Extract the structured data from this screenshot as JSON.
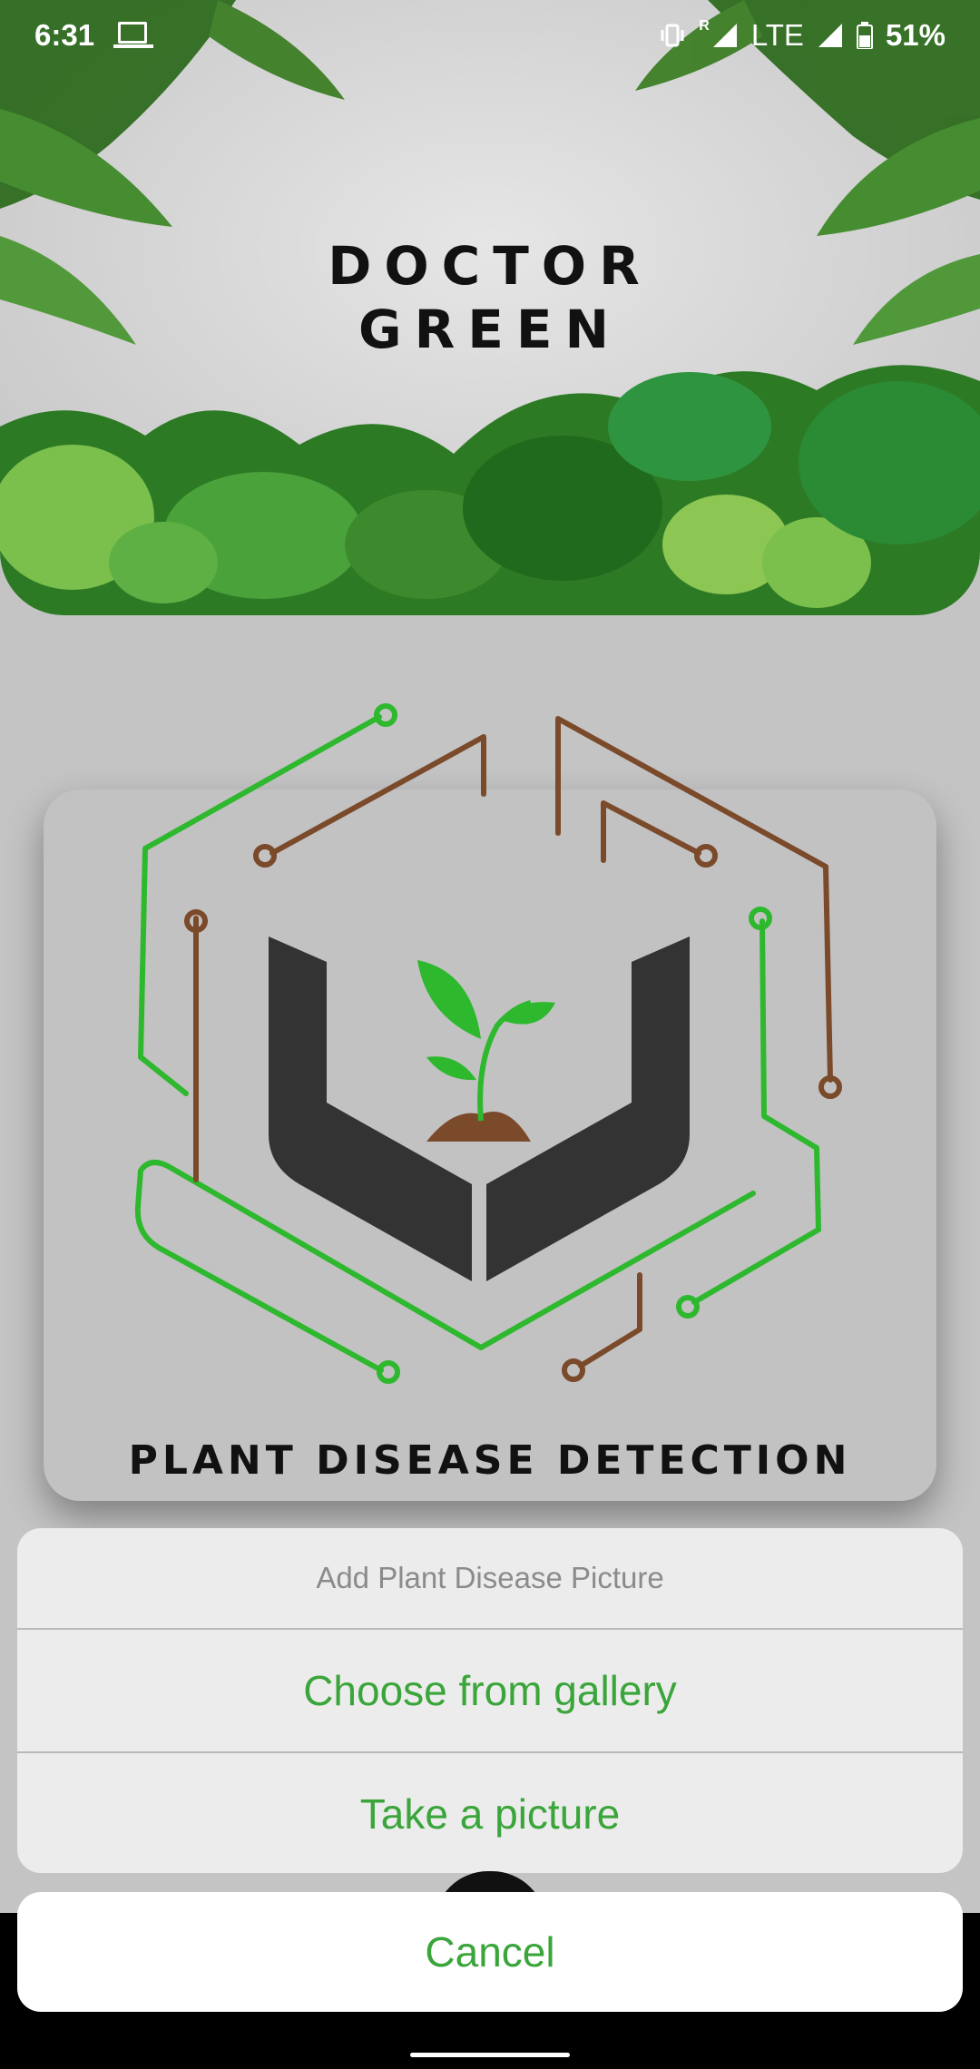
{
  "status_bar": {
    "time": "6:31",
    "network": "LTE",
    "roaming": "R",
    "battery": "51%"
  },
  "header": {
    "title_line1": "DOCTOR",
    "title_line2": "GREEN"
  },
  "logo": {
    "caption": "PLANT DISEASE DETECTION"
  },
  "action_sheet": {
    "title": "Add Plant Disease Picture",
    "options": [
      "Choose from gallery",
      "Take a picture"
    ],
    "cancel_label": "Cancel"
  },
  "colors": {
    "accent_green": "#3aa53a",
    "circuit_green": "#2eb82e",
    "circuit_brown": "#7a4a2a",
    "logo_dark": "#333333"
  }
}
